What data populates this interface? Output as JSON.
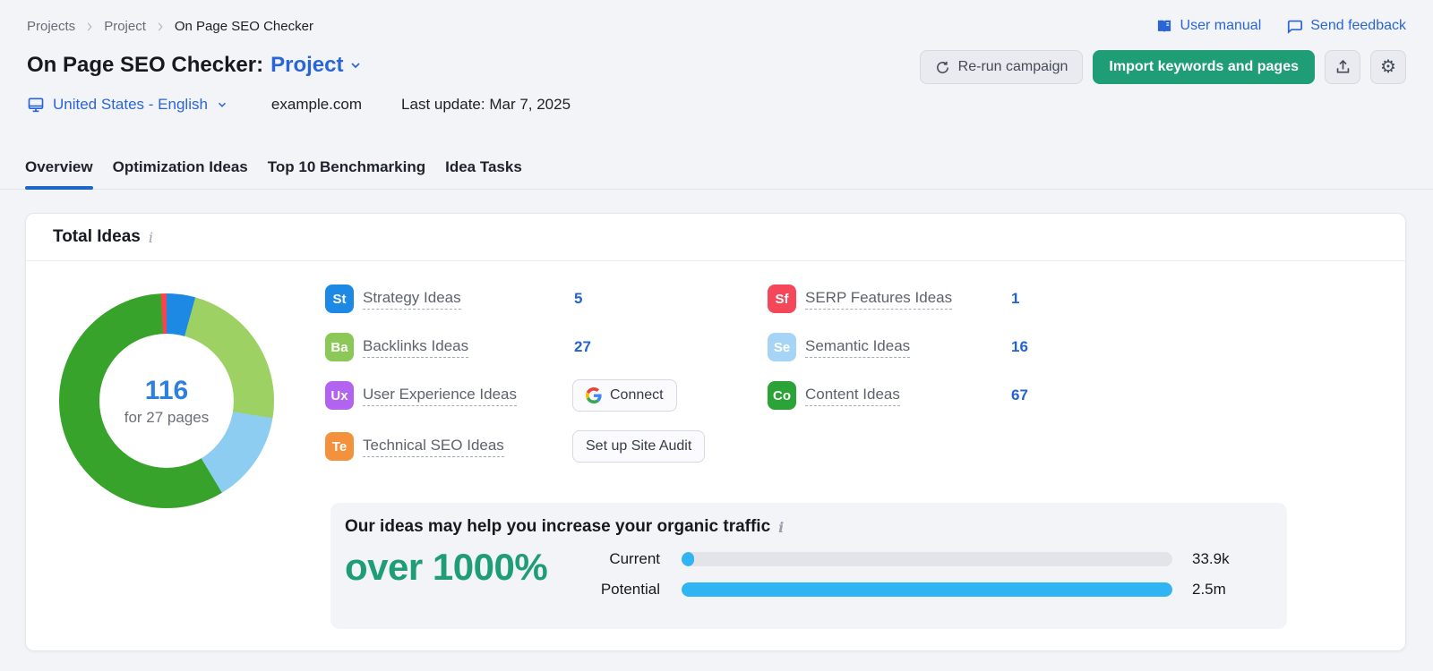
{
  "colors": {
    "page_bg": "#f3f4f8",
    "link_blue": "#2a65d8",
    "value_blue": "#2463cd",
    "active_tab_underline": "#1e66c8",
    "green_accent": "#1f9d74",
    "bar_blue": "#31b4f4",
    "bar_track": "#e2e4ea"
  },
  "icons": {
    "info": "i",
    "gear": "⚙"
  },
  "breadcrumb": {
    "items": [
      "Projects",
      "Project",
      "On Page SEO Checker"
    ]
  },
  "header_links": {
    "user_manual": "User manual",
    "send_feedback": "Send feedback"
  },
  "title": {
    "main": "On Page SEO Checker:",
    "project": "Project"
  },
  "actions": {
    "rerun": "Re-run campaign",
    "import": "Import keywords and pages"
  },
  "meta": {
    "locale": "United States - English",
    "domain": "example.com",
    "last_update": "Last update: Mar 7, 2025"
  },
  "tabs": [
    {
      "label": "Overview",
      "active": true
    },
    {
      "label": "Optimization Ideas",
      "active": false
    },
    {
      "label": "Top 10 Benchmarking",
      "active": false
    },
    {
      "label": "Idea Tasks",
      "active": false
    }
  ],
  "card": {
    "title": "Total Ideas",
    "donut_center": {
      "value": "116",
      "label": "for 27 pages"
    },
    "ideas_left": [
      {
        "badge": "St",
        "badge_color": "#1e88e5",
        "label": "Strategy Ideas",
        "value": "5"
      },
      {
        "badge": "Ba",
        "badge_color": "#8cc857",
        "label": "Backlinks Ideas",
        "value": "27"
      },
      {
        "badge": "Ux",
        "badge_color": "#b263f0",
        "label": "User Experience Ideas",
        "action": "Connect"
      },
      {
        "badge": "Te",
        "badge_color": "#f3913c",
        "label": "Technical SEO Ideas",
        "action": "Set up Site Audit"
      }
    ],
    "ideas_right": [
      {
        "badge": "Sf",
        "badge_color": "#f4485a",
        "label": "SERP Features Ideas",
        "value": "1"
      },
      {
        "badge": "Se",
        "badge_color": "#a6d4f6",
        "label": "Semantic Ideas",
        "value": "16"
      },
      {
        "badge": "Co",
        "badge_color": "#2ba336",
        "label": "Content Ideas",
        "value": "67"
      }
    ],
    "traffic": {
      "heading": "Our ideas may help you increase your organic traffic",
      "highlight": "over 1000%",
      "rows": [
        {
          "label": "Current",
          "value_label": "33.9k"
        },
        {
          "label": "Potential",
          "value_label": "2.5m"
        }
      ]
    }
  },
  "chart_data": [
    {
      "type": "pie",
      "title": "Total Ideas",
      "center_value": 116,
      "center_label": "for 27 pages",
      "labels": [
        "Strategy Ideas",
        "Backlinks Ideas",
        "Semantic Ideas",
        "Content Ideas",
        "SERP Features Ideas"
      ],
      "values": [
        5,
        27,
        16,
        67,
        1
      ],
      "colors": [
        "#1e88e5",
        "#9ed163",
        "#8ecdf2",
        "#38a32b",
        "#f6454e"
      ]
    },
    {
      "type": "bar",
      "title": "Our ideas may help you increase your organic traffic",
      "categories": [
        "Current",
        "Potential"
      ],
      "values": [
        33900,
        2500000
      ],
      "value_labels": [
        "33.9k",
        "2.5m"
      ],
      "bar_color": "#31b4f4",
      "track_color": "#e2e4ea",
      "xlim": [
        0,
        2500000
      ]
    }
  ]
}
